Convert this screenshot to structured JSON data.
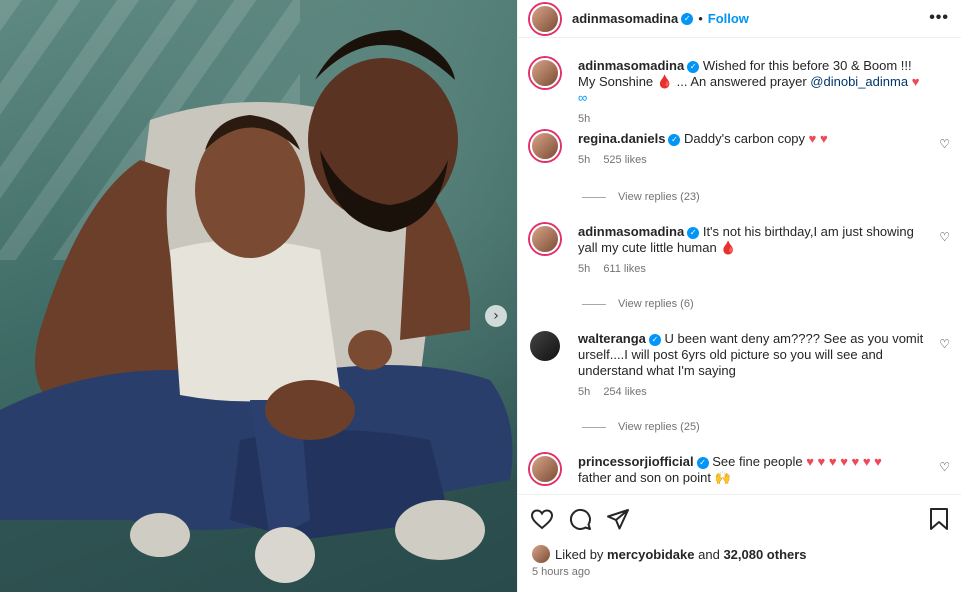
{
  "post": {
    "author": "adinmasomadina",
    "follow_label": "Follow",
    "dot": "•",
    "more": "•••",
    "carousel_next": "›"
  },
  "caption": {
    "username": "adinmasomadina",
    "text_a": "Wished for this before 30 & Boom !!! My Sonshine",
    "emoji_a": "🩸",
    "text_b": "... An answered prayer",
    "mention": "@dinobi_adinma",
    "emoji_b": "♥",
    "emoji_c": "∞",
    "time": "5h"
  },
  "comments": [
    {
      "username": "regina.daniels",
      "text": "Daddy's carbon copy",
      "emoji": "♥ ♥",
      "time": "5h",
      "likes": "525 likes",
      "replies": "View replies (23)"
    },
    {
      "username": "adinmasomadina",
      "text": "It's not his birthday,I am just showing yall my cute little human",
      "emoji": "🩸",
      "time": "5h",
      "likes": "611 likes",
      "replies": "View replies (6)"
    },
    {
      "username": "walteranga",
      "text": "U been want deny am???? See as you vomit urself....I will post 6yrs old picture so you will see and understand what I'm saying",
      "emoji": "",
      "time": "5h",
      "likes": "254 likes",
      "replies": "View replies (25)"
    },
    {
      "username": "princessorjiofficial",
      "text": "See fine people",
      "emoji": "♥ ♥ ♥ ♥ ♥ ♥ ♥",
      "text2": "father and son on point",
      "emoji2": "🙌"
    }
  ],
  "footer": {
    "liked_prefix": "Liked by",
    "liked_user": "mercyobidake",
    "liked_and": "and",
    "liked_others": "32,080 others",
    "time_ago": "5 hours ago"
  },
  "icons": {
    "like": "heart-icon",
    "comment": "comment-icon",
    "share": "share-icon",
    "save": "bookmark-icon",
    "verified": "verified-badge-icon"
  },
  "colors": {
    "accent": "#0095f6",
    "heart": "#ed4956",
    "muted": "#737373"
  }
}
